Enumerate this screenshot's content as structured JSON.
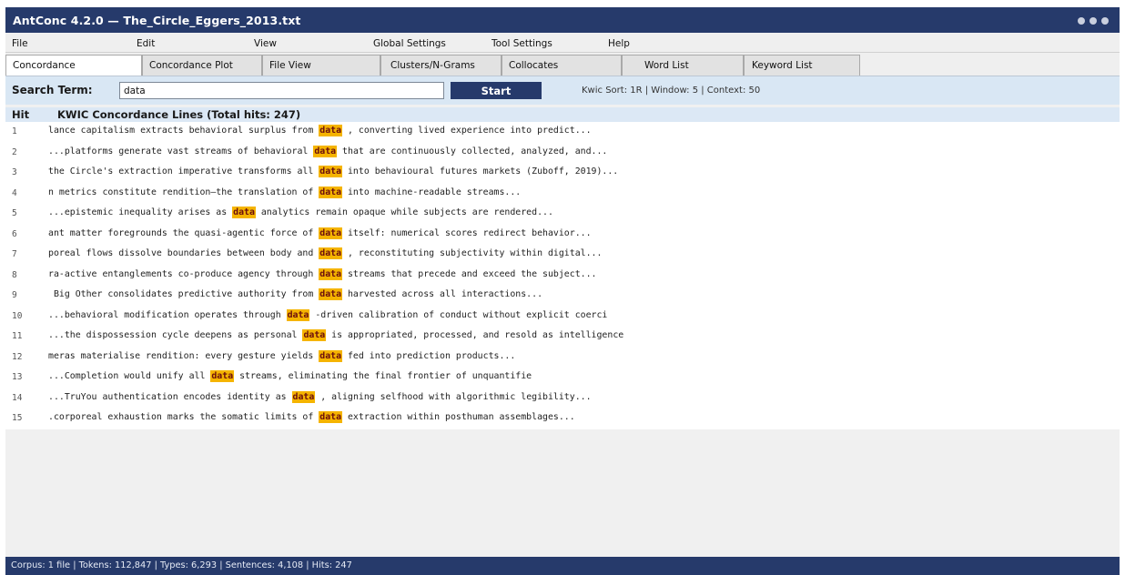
{
  "window": {
    "title": "AntConc 4.2.0  —  The_Circle_Eggers_2013.txt"
  },
  "menu": [
    "File",
    "Edit",
    "View",
    "Global Settings",
    "Tool Settings",
    "Help"
  ],
  "tabs": [
    {
      "label": "Concordance",
      "active": true
    },
    {
      "label": "Concordance Plot",
      "active": false
    },
    {
      "label": "File View",
      "active": false
    },
    {
      "label": "Clusters/N-Grams",
      "active": false
    },
    {
      "label": "Collocates",
      "active": false
    },
    {
      "label": "Word List",
      "active": false
    },
    {
      "label": "Keyword List",
      "active": false
    }
  ],
  "search": {
    "label": "Search Term:",
    "value": "data",
    "start_label": "Start",
    "settings": "Kwic Sort: 1R  |  Window: 5  |  Context: 50"
  },
  "results": {
    "col_hit": "Hit",
    "col_kwic": "KWIC Concordance Lines  (Total hits: 247)",
    "rows": [
      {
        "hit": "1",
        "left": "lance capitalism extracts behavioral surplus from ",
        "kw": "data",
        "right": " , converting lived experience into predict..."
      },
      {
        "hit": "2",
        "left": "...platforms generate vast streams of behavioral ",
        "kw": "data",
        "right": " that are continuously collected, analyzed, and..."
      },
      {
        "hit": "3",
        "left": "the Circle's extraction imperative transforms all ",
        "kw": "data",
        "right": " into behavioural futures markets (Zuboff, 2019)..."
      },
      {
        "hit": "4",
        "left": "n metrics constitute rendition—the translation of ",
        "kw": "data",
        "right": " into machine-readable streams..."
      },
      {
        "hit": "5",
        "left": "...epistemic inequality arises as ",
        "kw": "data",
        "right": " analytics remain opaque while subjects are rendered..."
      },
      {
        "hit": "6",
        "left": "ant matter foregrounds the quasi-agentic force of ",
        "kw": "data",
        "right": " itself: numerical scores redirect behavior..."
      },
      {
        "hit": "7",
        "left": "poreal flows dissolve boundaries between body and ",
        "kw": "data",
        "right": " , reconstituting subjectivity within digital..."
      },
      {
        "hit": "8",
        "left": "ra-active entanglements co-produce agency through ",
        "kw": "data",
        "right": " streams that precede and exceed the subject..."
      },
      {
        "hit": "9",
        "left": " Big Other consolidates predictive authority from ",
        "kw": "data",
        "right": " harvested across all interactions..."
      },
      {
        "hit": "10",
        "left": "...behavioral modification operates through ",
        "kw": "data",
        "right": " -driven calibration of conduct without explicit coerci"
      },
      {
        "hit": "11",
        "left": "...the dispossession cycle deepens as personal ",
        "kw": "data",
        "right": " is appropriated, processed, and resold as intelligence"
      },
      {
        "hit": "12",
        "left": "meras materialise rendition: every gesture yields ",
        "kw": "data",
        "right": " fed into prediction products..."
      },
      {
        "hit": "13",
        "left": "...Completion would unify all ",
        "kw": "data",
        "right": " streams, eliminating the final frontier of unquantifie"
      },
      {
        "hit": "14",
        "left": "...TruYou authentication encodes identity as ",
        "kw": "data",
        "right": " , aligning selfhood with algorithmic legibility..."
      },
      {
        "hit": "15",
        "left": ".corporeal exhaustion marks the somatic limits of ",
        "kw": "data",
        "right": " extraction within posthuman assemblages..."
      }
    ]
  },
  "status": "Corpus: 1 file  |  Tokens: 112,847  |  Types: 6,293  |  Sentences: 4,108  |  Hits: 247"
}
